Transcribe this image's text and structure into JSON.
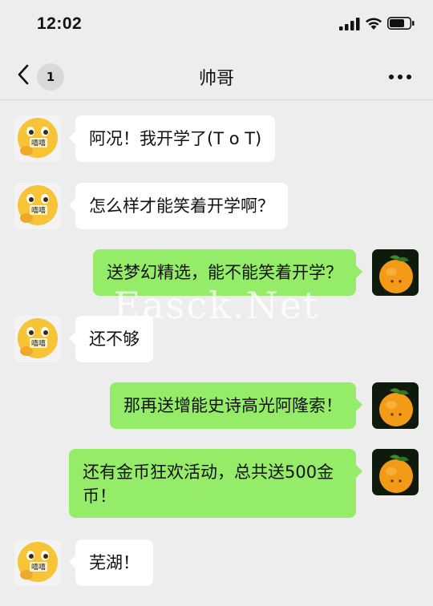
{
  "status_bar": {
    "time": "12:02"
  },
  "nav": {
    "unread_count": "1",
    "title": "帅哥"
  },
  "messages": [
    {
      "side": "left",
      "avatar": "emoji-avatar",
      "text": "阿况！我开学了(T o T)"
    },
    {
      "side": "left",
      "avatar": "emoji-avatar",
      "text": "怎么样才能笑着开学啊？"
    },
    {
      "side": "right",
      "avatar": "orange-avatar",
      "text": "送梦幻精选，能不能笑着开学？"
    },
    {
      "side": "left",
      "avatar": "emoji-avatar",
      "text": "还不够"
    },
    {
      "side": "right",
      "avatar": "orange-avatar",
      "text": "那再送增能史诗高光阿隆索！"
    },
    {
      "side": "right",
      "avatar": "orange-avatar",
      "text": "还有金币狂欢活动，总共送500金币！"
    },
    {
      "side": "left",
      "avatar": "emoji-avatar",
      "text": "芜湖！"
    }
  ],
  "avatar_badge": "嘻嘻",
  "watermark": "Easck.Net",
  "colors": {
    "background": "#ededed",
    "sent_bubble": "#95ec69",
    "received_bubble": "#ffffff"
  }
}
